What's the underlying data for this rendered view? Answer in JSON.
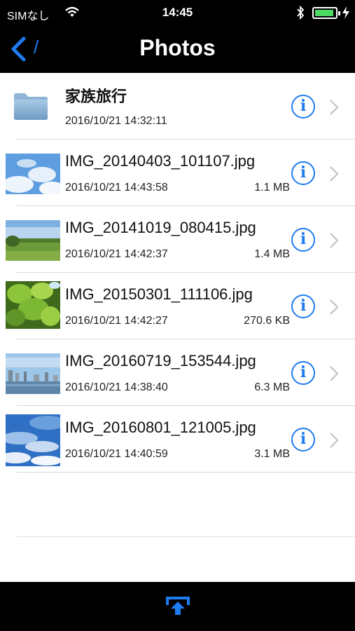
{
  "status_bar": {
    "carrier": "SIMなし",
    "time": "14:45",
    "icons": [
      "wifi-icon",
      "bluetooth-icon",
      "battery-icon",
      "charging-bolt-icon"
    ]
  },
  "nav": {
    "back_icon": "chevron-left-icon",
    "path": "/",
    "title": "Photos"
  },
  "items": [
    {
      "name": "家族旅行",
      "date": "2016/10/21 14:32:11",
      "size": "",
      "type": "folder",
      "icon": "folder-icon"
    },
    {
      "name": "IMG_20140403_101107.jpg",
      "date": "2016/10/21 14:43:58",
      "size": "1.1 MB",
      "type": "image"
    },
    {
      "name": "IMG_20141019_080415.jpg",
      "date": "2016/10/21 14:42:37",
      "size": "1.4 MB",
      "type": "image"
    },
    {
      "name": "IMG_20150301_111106.jpg",
      "date": "2016/10/21 14:42:27",
      "size": "270.6 KB",
      "type": "image"
    },
    {
      "name": "IMG_20160719_153544.jpg",
      "date": "2016/10/21 14:38:40",
      "size": "6.3 MB",
      "type": "image"
    },
    {
      "name": "IMG_20160801_121005.jpg",
      "date": "2016/10/21 14:40:59",
      "size": "3.1 MB",
      "type": "image"
    }
  ],
  "row_icons": {
    "info": "info-icon",
    "disclosure": "chevron-right-icon"
  },
  "toolbar": {
    "share_icon": "share-upload-icon"
  },
  "colors": {
    "accent": "#1e7cf0",
    "bar_background": "#000000",
    "battery": "#4cd964"
  }
}
